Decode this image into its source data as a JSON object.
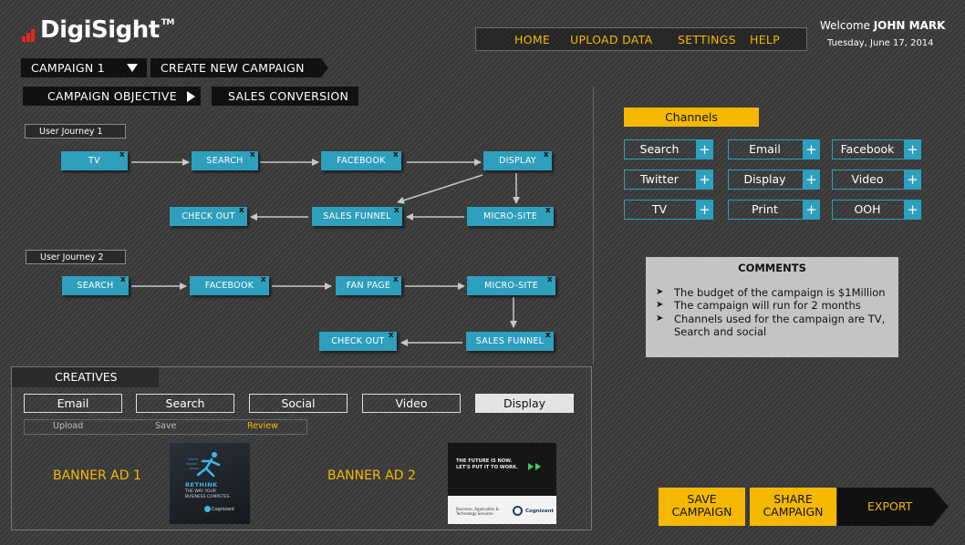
{
  "app": {
    "name": "DigiSight",
    "tm": "TM"
  },
  "nav": {
    "items": [
      "HOME",
      "UPLOAD DATA",
      "SETTINGS",
      "HELP"
    ]
  },
  "user": {
    "welcome_prefix": "Welcome",
    "name": "JOHN MARK",
    "date": "Tuesday, June 17, 2014"
  },
  "campaign": {
    "selector_label": "CAMPAIGN 1",
    "create_label": "CREATE NEW CAMPAIGN",
    "objective_label": "CAMPAIGN OBJECTIVE",
    "objective_value": "SALES CONVERSION"
  },
  "journeys": [
    {
      "label": "User Journey 1",
      "nodes": [
        "TV",
        "SEARCH",
        "FACEBOOK",
        "DISPLAY",
        "MICRO-SITE",
        "SALES FUNNEL",
        "CHECK OUT"
      ]
    },
    {
      "label": "User Journey 2",
      "nodes": [
        "SEARCH",
        "FACEBOOK",
        "FAN PAGE",
        "MICRO-SITE",
        "SALES FUNNEL",
        "CHECK OUT"
      ]
    }
  ],
  "node_remove_label": "x",
  "channels": {
    "header": "Channels",
    "items": [
      "Search",
      "Email",
      "Facebook",
      "Twitter",
      "Display",
      "Video",
      "TV",
      "Print",
      "OOH"
    ],
    "add_label": "+"
  },
  "comments": {
    "title": "COMMENTS",
    "bullet": "➤",
    "items": [
      "The budget of the campaign is $1Million",
      "The campaign will run for 2 months",
      "Channels used for the campaign are TV, Search and social"
    ]
  },
  "creatives": {
    "title": "CREATIVES",
    "tabs": [
      "Email",
      "Search",
      "Social",
      "Video",
      "Display"
    ],
    "active_tab": "Display",
    "actions": [
      "Upload",
      "Save",
      "Review"
    ],
    "active_action": "Review",
    "banners": [
      {
        "label": "BANNER AD 1",
        "thumb_text": [
          "RETHINK",
          "THE WAY YOUR",
          "BUSINESS COMPETES.",
          "Cognizant"
        ]
      },
      {
        "label": "BANNER AD 2",
        "thumb_text": [
          "THE FUTURE IS NOW.",
          "LET'S PUT IT TO WORK.",
          "Business, Application &",
          "Technology Services",
          "Cognizant"
        ]
      }
    ]
  },
  "actions": {
    "save": [
      "SAVE",
      "CAMPAIGN"
    ],
    "share": [
      "SHARE",
      "CAMPAIGN"
    ],
    "export": "EXPORT"
  },
  "colors": {
    "accent_yellow": "#f5b800",
    "node_blue": "#2e9fbd",
    "logo_red": "#e3281f",
    "background": "#3b3b3b"
  }
}
